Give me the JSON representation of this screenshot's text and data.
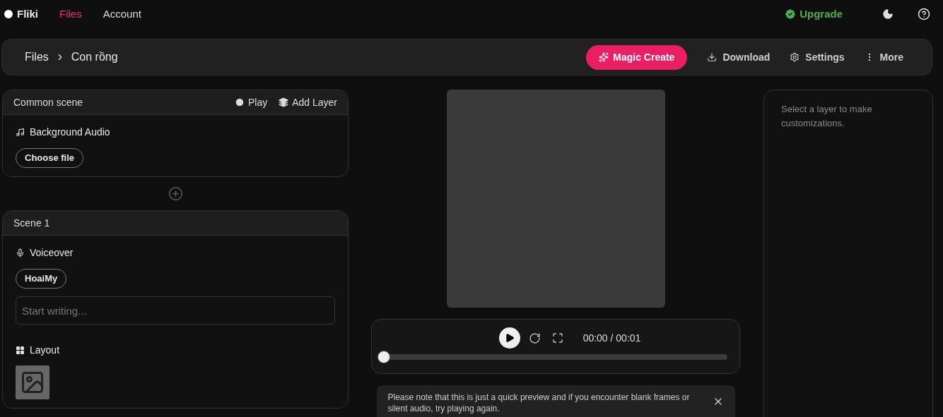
{
  "nav": {
    "brand": "Fliki",
    "links": [
      {
        "label": "Files",
        "selected": true
      },
      {
        "label": "Account",
        "selected": false
      }
    ],
    "upgrade": "Upgrade"
  },
  "toolbar": {
    "breadcrumb": [
      "Files",
      "Con rồng"
    ],
    "magic": "Magic Create",
    "actions": [
      {
        "kind": "download",
        "label": "Download"
      },
      {
        "kind": "settings",
        "label": "Settings"
      },
      {
        "kind": "more",
        "label": "More"
      }
    ]
  },
  "common_scene": {
    "title": "Common scene",
    "play": "Play",
    "add_layer": "Add Layer",
    "audio_label": "Background Audio",
    "choose": "Choose file"
  },
  "scene": {
    "title": "Scene 1",
    "voiceover": "Voiceover",
    "voice": "HoaiMy",
    "placeholder": "Start writing...",
    "layout": "Layout"
  },
  "player": {
    "time": "00:00 / 00:01",
    "level": 0
  },
  "notice": "Please note that this is just a quick preview and if you encounter blank frames or silent audio, try playing again.",
  "inspector": {
    "hint": "Select a layer to make customizations."
  }
}
